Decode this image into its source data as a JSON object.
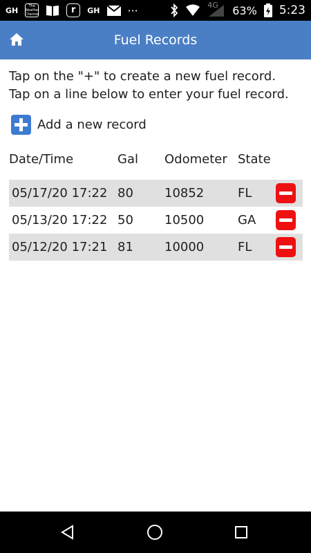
{
  "status_bar": {
    "left_icons": [
      "gh-icon",
      "weather-channel-icon",
      "book-icon",
      "r-icon",
      "gh-icon",
      "mail-icon",
      "more-icon"
    ],
    "weather_text": "The Weather Channel",
    "gh_text": "GH",
    "r_text": "r",
    "more_text": "···",
    "network": "4G",
    "battery_percent": "63%",
    "time": "5:23"
  },
  "app_bar": {
    "title": "Fuel Records",
    "bar_color": "#4a7fc6"
  },
  "instructions": {
    "line1": "Tap on the \"+\" to create a new fuel record.",
    "line2": "Tap on a line below to enter your fuel record."
  },
  "add_record": {
    "label": "Add a new record",
    "icon_color": "#3d7bd1"
  },
  "table": {
    "headers": {
      "date": "Date/Time",
      "gal": "Gal",
      "odometer": "Odometer",
      "state": "State"
    },
    "rows": [
      {
        "date": "05/17/20 17:22",
        "gal": "80",
        "odometer": "10852",
        "state": "FL"
      },
      {
        "date": "05/13/20 17:22",
        "gal": "50",
        "odometer": "10500",
        "state": "GA"
      },
      {
        "date": "05/12/20 17:21",
        "gal": "81",
        "odometer": "10000",
        "state": "FL"
      }
    ],
    "delete_color": "#ee1111",
    "shaded_row_color": "#e0e0e0"
  },
  "nav_bar": {
    "buttons": [
      "back-icon",
      "home-circle-icon",
      "recents-icon"
    ]
  }
}
